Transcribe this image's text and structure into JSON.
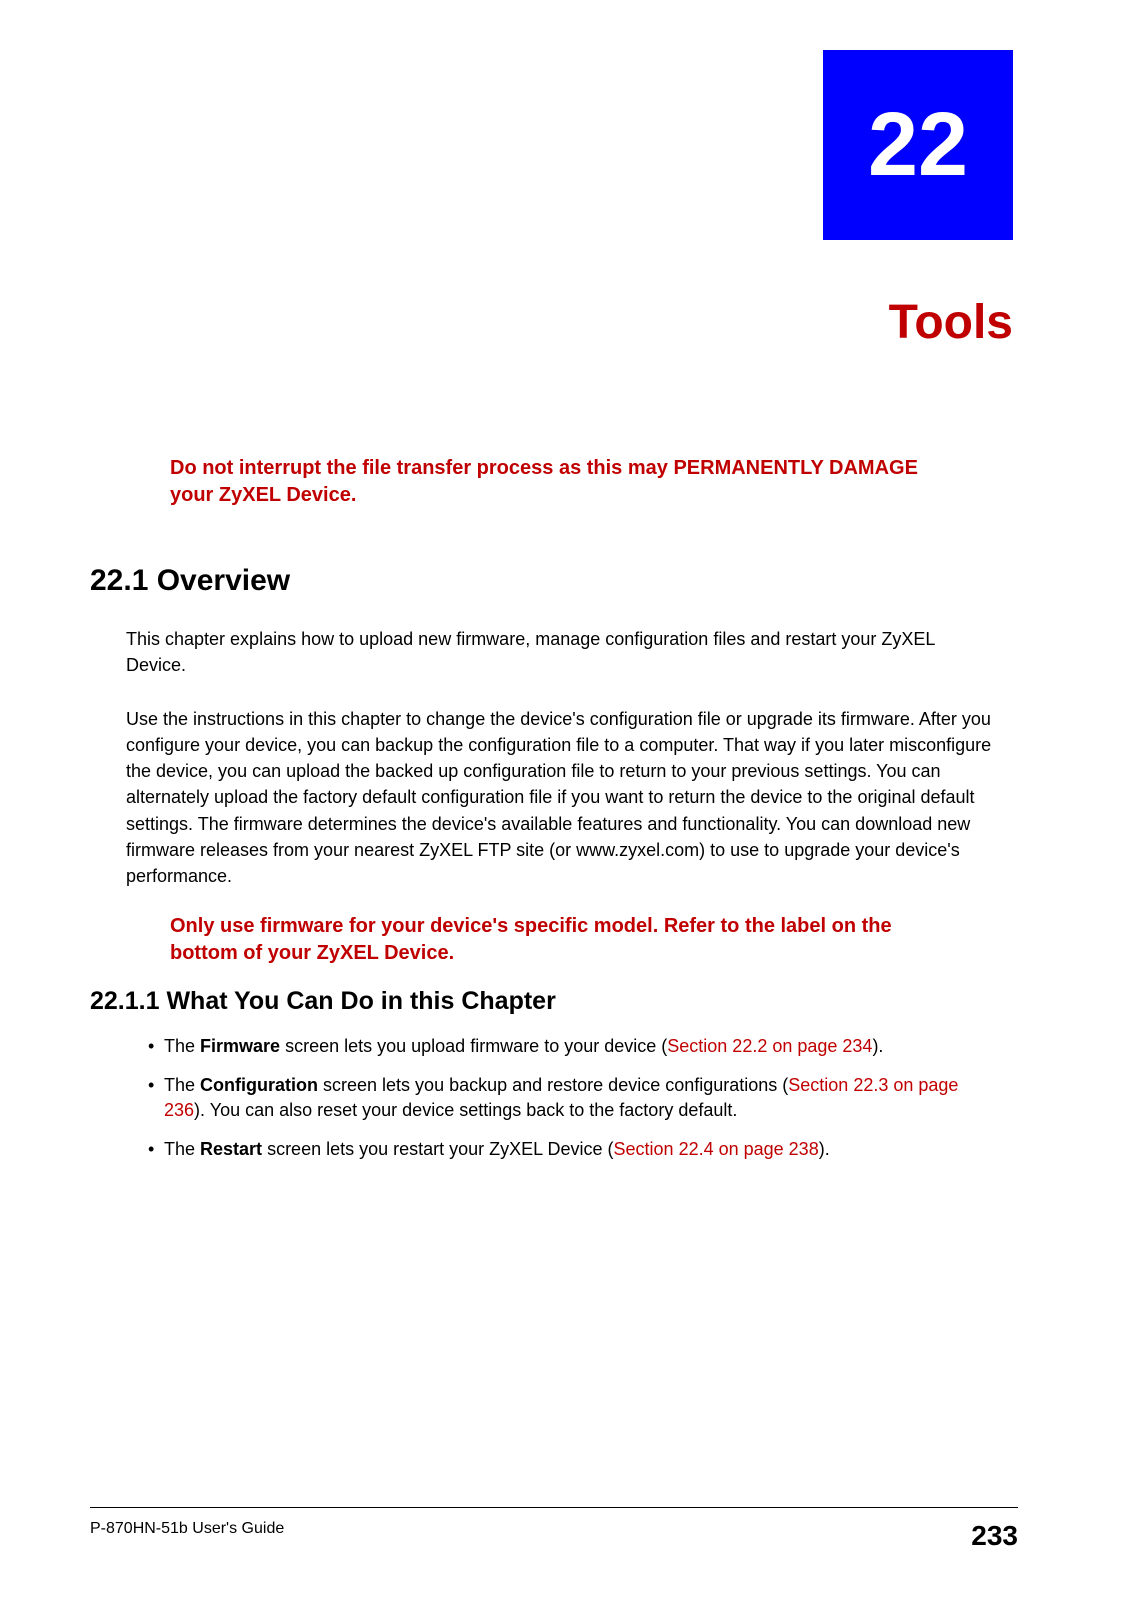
{
  "chapter": {
    "number": "22",
    "title": "Tools"
  },
  "warnings": {
    "top": "Do not interrupt the file transfer process as this may PERMANENTLY DAMAGE your ZyXEL Device.",
    "firmware": "Only use firmware for your device's specific model. Refer to the label on the bottom of your ZyXEL Device."
  },
  "sections": {
    "overview_heading": "22.1  Overview",
    "overview_p1": "This chapter explains how to upload new firmware, manage configuration files and restart your ZyXEL Device.",
    "overview_p2": "Use the instructions in this chapter to change the device's configuration file or upgrade its firmware. After you configure your device, you can backup the configuration file to a computer. That way if you later misconfigure the device, you can upload the backed up configuration file to return to your previous settings. You can alternately upload the factory default configuration file if you want to return the device to the original default settings. The firmware determines the device's available features and functionality. You can download new firmware releases from your nearest ZyXEL FTP site (or www.zyxel.com) to use to upgrade your device's performance.",
    "whatyoucando_heading": "22.1.1  What You Can Do in this Chapter",
    "bullets": [
      {
        "pre": "The ",
        "bold": "Firmware",
        "mid": " screen lets you upload firmware to your device (",
        "link": "Section 22.2 on page 234",
        "post": ")."
      },
      {
        "pre": "The ",
        "bold": "Configuration",
        "mid": " screen lets you backup and restore device configurations (",
        "link": "Section 22.3 on page 236",
        "post": "). You can also reset your device settings back to the factory default."
      },
      {
        "pre": "The ",
        "bold": "Restart",
        "mid": " screen lets you restart your ZyXEL Device (",
        "link": "Section 22.4 on page 238",
        "post": ")."
      }
    ]
  },
  "footer": {
    "guide": "P-870HN-51b User's Guide",
    "page": "233"
  }
}
